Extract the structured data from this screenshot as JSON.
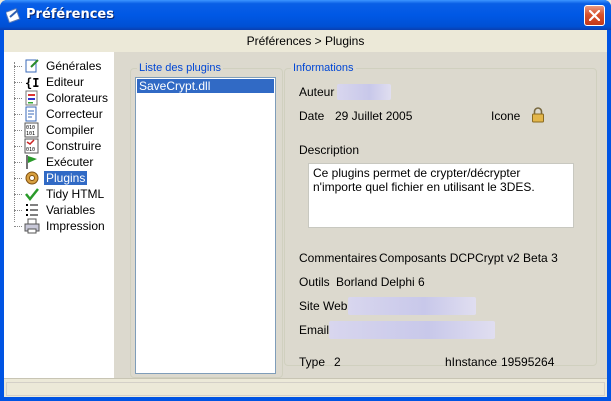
{
  "window": {
    "title": "Préférences",
    "close_icon": "close-icon"
  },
  "breadcrumb": "Préférences > Plugins",
  "sidebar": {
    "items": [
      {
        "label": "Générales",
        "icon": "general-settings-icon"
      },
      {
        "label": "Editeur",
        "icon": "editor-icon"
      },
      {
        "label": "Colorateurs",
        "icon": "syntax-colors-icon"
      },
      {
        "label": "Correcteur",
        "icon": "spell-check-icon"
      },
      {
        "label": "Compiler",
        "icon": "compile-icon"
      },
      {
        "label": "Construire",
        "icon": "build-icon"
      },
      {
        "label": "Exécuter",
        "icon": "run-flag-icon"
      },
      {
        "label": "Plugins",
        "icon": "plugin-gear-icon",
        "selected": true
      },
      {
        "label": "Tidy HTML",
        "icon": "checkmark-icon"
      },
      {
        "label": "Variables",
        "icon": "variables-list-icon"
      },
      {
        "label": "Impression",
        "icon": "printer-icon"
      }
    ]
  },
  "plugins": {
    "group_title": "Liste des plugins",
    "items": [
      "SaveCrypt.dll"
    ]
  },
  "info": {
    "group_title": "Informations",
    "author_label": "Auteur",
    "date_label": "Date",
    "date_value": "29 Juillet 2005",
    "icon_label": "Icone",
    "icon_name": "padlock-icon",
    "description_label": "Description",
    "description_value": "Ce plugins permet de crypter/décrypter n'importe quel fichier en utilisant le 3DES.",
    "comments_label": "Commentaires",
    "comments_value": "Composants DCPCrypt v2 Beta 3",
    "tools_label": "Outils",
    "tools_value": "Borland Delphi 6",
    "website_label": "Site Web",
    "email_label": "Email",
    "type_label": "Type",
    "type_value": "2",
    "hinstance_label": "hInstance",
    "hinstance_value": "19595264"
  },
  "colors": {
    "titlebar": "#0054e3",
    "selection": "#316ac5",
    "group_title": "#0046d5",
    "close_button": "#d9522c"
  }
}
